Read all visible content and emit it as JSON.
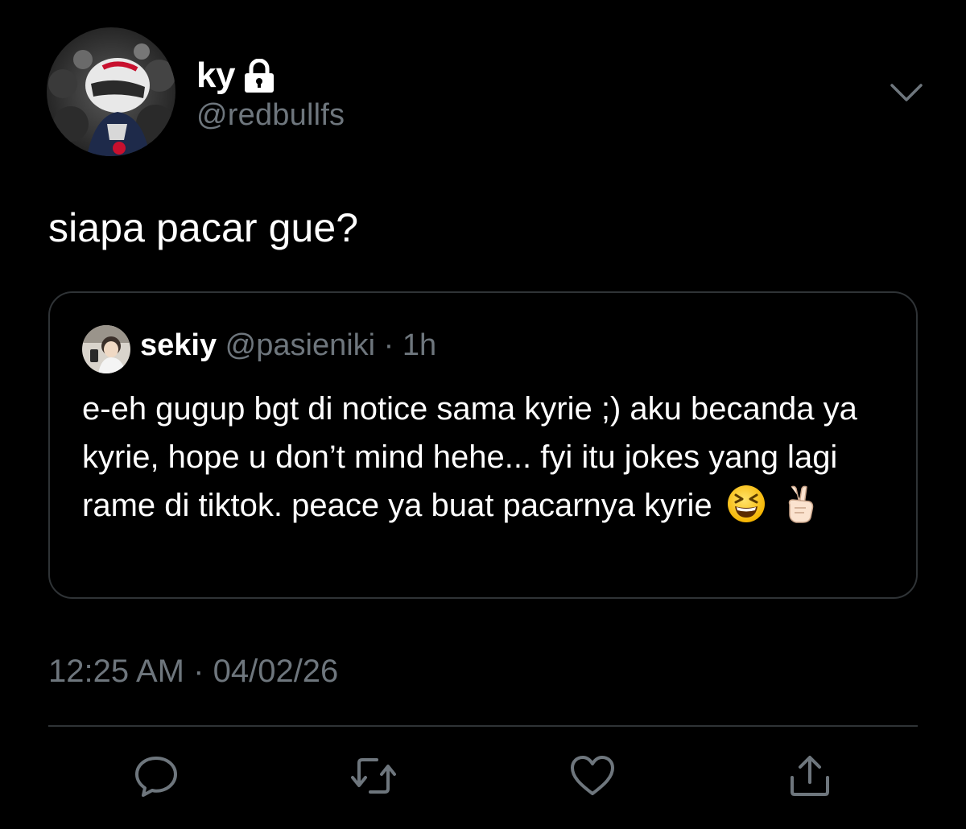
{
  "tweet": {
    "display_name": "ky",
    "username": "@redbullfs",
    "protected_icon": "lock-icon",
    "text": "siapa pacar gue?",
    "timestamp": "12:25 AM",
    "separator": "·",
    "date": "04/02/26"
  },
  "quoted_tweet": {
    "display_name": "sekiy",
    "username": "@pasieniki",
    "separator": "·",
    "time": "1h",
    "text": "e-eh gugup bgt di notice sama kyrie ;) aku becanda ya kyrie, hope u don’t mind hehe... fyi itu jokes yang lagi rame di tiktok. peace ya buat pacarnya kyrie",
    "emojis": [
      "grinning-squinting-face",
      "victory-hand"
    ]
  },
  "actions": {
    "icons": [
      "reply-icon",
      "retweet-icon",
      "like-icon",
      "share-icon"
    ]
  },
  "colors": {
    "background": "#000000",
    "primary_text": "#ffffff",
    "secondary_text": "#6e767d",
    "border": "#2f3336"
  }
}
